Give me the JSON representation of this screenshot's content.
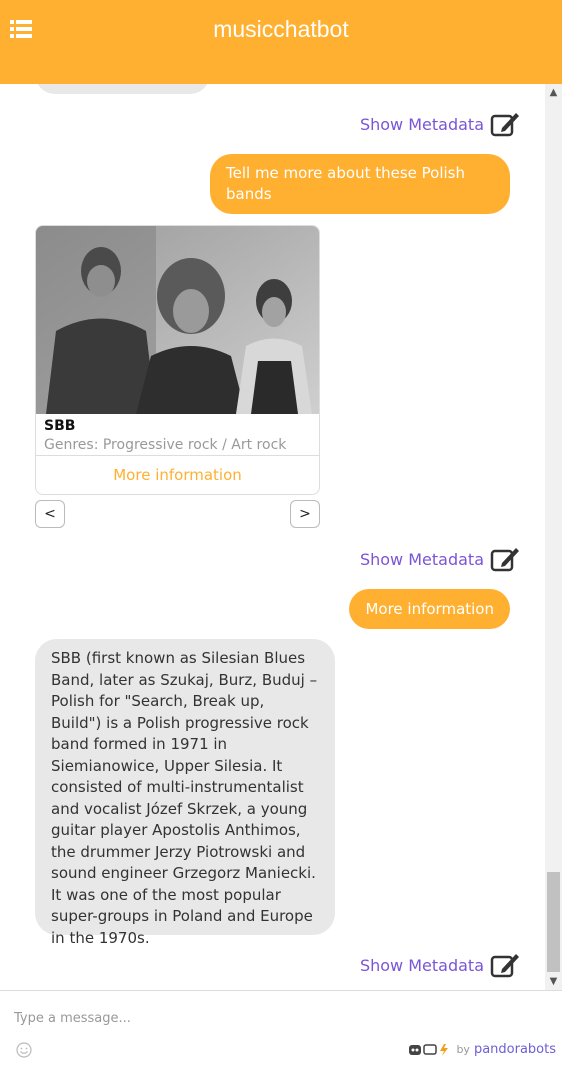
{
  "header": {
    "title": "musicchatbot"
  },
  "messages": {
    "meta_label": "Show Metadata",
    "user_1": "Tell me more about these Polish bands",
    "card": {
      "title": "SBB",
      "subtitle": "Genres: Progressive rock / Art rock",
      "button": "More information",
      "prev": "<",
      "next": ">"
    },
    "user_2": "More information",
    "bot_text": "SBB (first known as Silesian Blues Band, later as Szukaj, Burz, Buduj – Polish for \"Search, Break up, Build\") is a Polish progressive rock band formed in 1971 in Siemianowice, Upper Silesia. It consisted of multi-instrumentalist and vocalist Józef Skrzek, a young guitar player Apostolis Anthimos, the drummer Jerzy Piotrowski and sound engineer Grzegorz Maniecki. It was one of the most popular super-groups in Poland and Europe in the 1970s."
  },
  "input": {
    "placeholder": "Type a message..."
  },
  "footer": {
    "by": "by",
    "brand": "pandorabots"
  },
  "colors": {
    "accent": "#ffb030",
    "link": "#7a55d6",
    "bubble_bot": "#e8e8e8"
  },
  "icons": [
    "menu-icon",
    "edit-icon",
    "emoji-icon",
    "pandorabots-logo-icon"
  ]
}
